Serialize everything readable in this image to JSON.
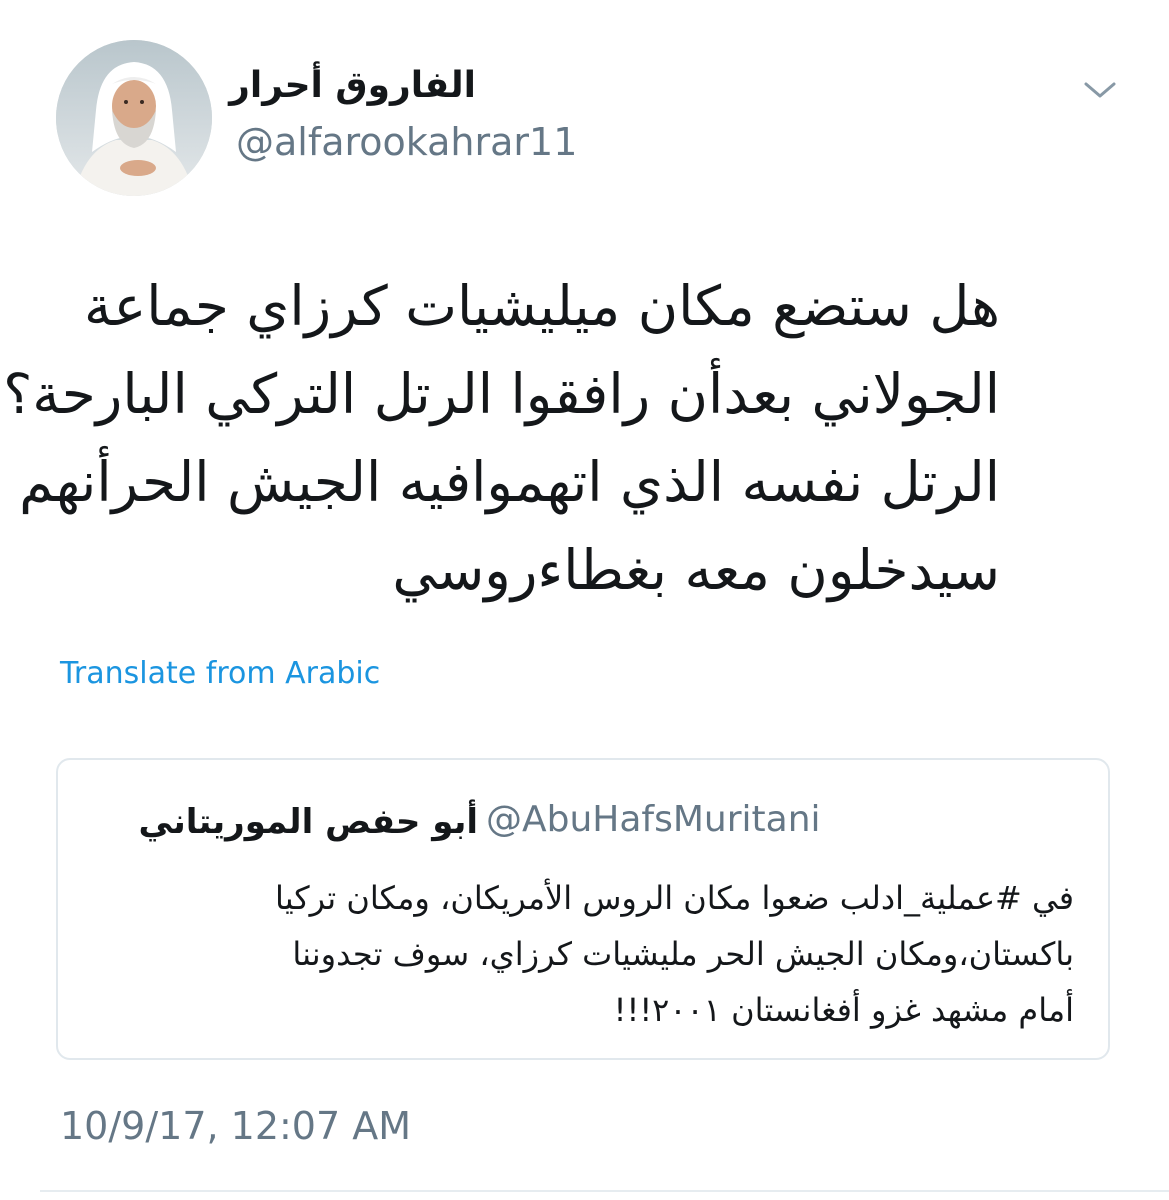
{
  "author": {
    "display_name": "الفاروق أحرار",
    "handle": "@alfarookahrar11",
    "avatar_icon": "profile-photo"
  },
  "menu": {
    "caret_icon": "chevron-down-icon"
  },
  "tweet": {
    "lines": [
      "هل ستضع مكان ميليشيات كرزاي جماعة",
      "الجولاني بعدأن رافقوا الرتل التركي البارحة؟",
      "الرتل نفسه الذي اتهموافيه الجيش الحرأنهم",
      "سيدخلون معه بغطاءروسي"
    ],
    "translate_label": "Translate from Arabic",
    "timestamp": "10/9/17, 12:07 AM"
  },
  "quoted_tweet": {
    "display_name": "أبو حفص الموريتاني",
    "handle": "@AbuHafsMuritani",
    "lines": [
      "في #عملية_ادلب ضعوا مكان الروس الأمريكان، ومكان تركيا",
      "باكستان،ومكان الجيش الحر مليشيات كرزاي، سوف تجدوننا",
      "أمام مشهد غزو أفغانستان ٢٠٠١!!!"
    ]
  },
  "colors": {
    "link": "#1b95e0",
    "secondary_text": "#657786",
    "border": "#e1e8ed"
  }
}
